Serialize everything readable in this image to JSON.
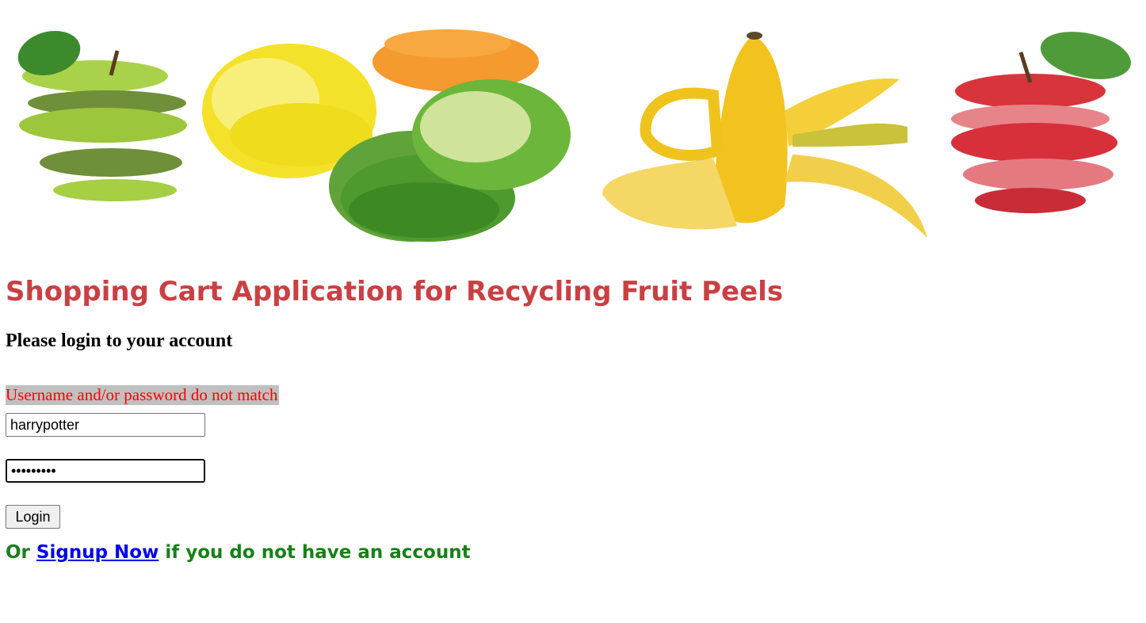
{
  "banner": {
    "fruits": [
      "green-apple-peel",
      "lemon-peel",
      "orange-peel",
      "lime-peel",
      "banana-peel",
      "red-apple-peel"
    ]
  },
  "page": {
    "title": "Shopping Cart Application for Recycling Fruit Peels",
    "subtitle": "Please login to your account"
  },
  "login": {
    "error_message": "Username and/or password do not match",
    "username_value": "harrypotter",
    "password_value": "harrypott",
    "login_label": "Login"
  },
  "signup": {
    "prefix": "Or ",
    "link_label": "Signup Now",
    "suffix": " if you do not have an account"
  },
  "colors": {
    "title": "#c94043",
    "error_text": "#ff0000",
    "error_bg": "#c0c0c0",
    "signup_text": "#178017",
    "link": "#0000ee"
  }
}
